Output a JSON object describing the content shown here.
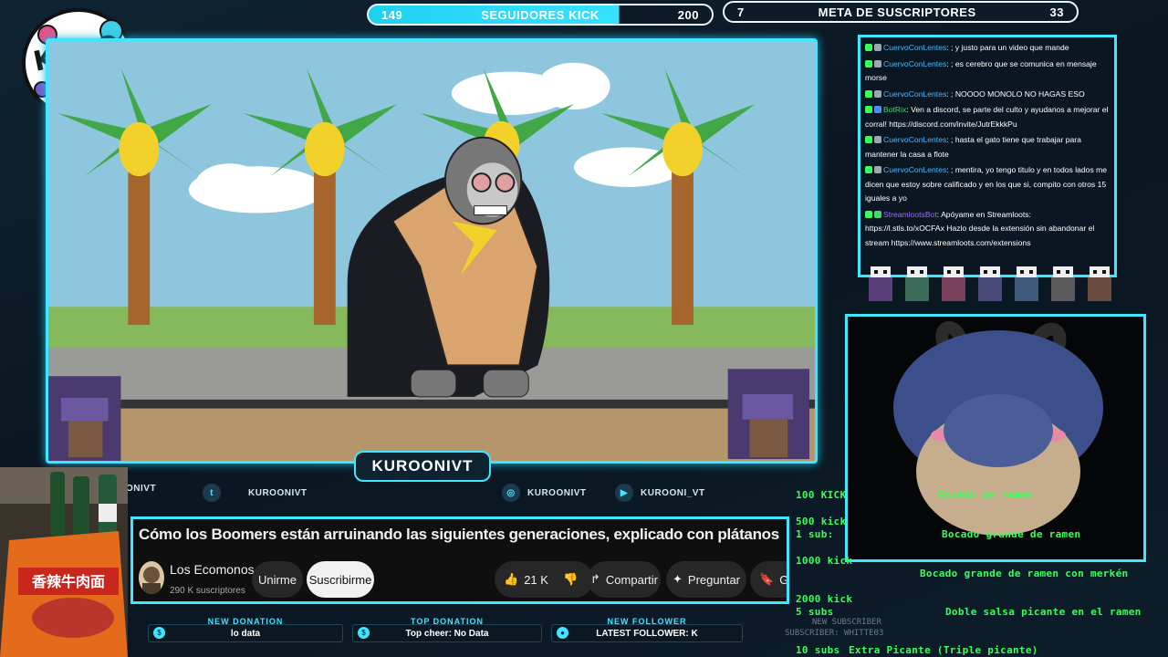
{
  "kick_followers_bar": {
    "start": "149",
    "label": "SEGUIDORES KICK",
    "goal": "200",
    "progress": 0.73
  },
  "subs_goal_bar": {
    "start": "7",
    "label": "META DE SUSCRIPTORES",
    "goal": "33",
    "progress": 0.0
  },
  "logo": {
    "text": "KUROONI VT"
  },
  "chat": {
    "messages": [
      {
        "user": "CuervoConLentes",
        "text": ": ; y justo para un video que mande",
        "type": "user"
      },
      {
        "user": "CuervoConLentes",
        "text": ": ; es cerebro que se comunica en mensaje morse",
        "type": "user"
      },
      {
        "user": "CuervoConLentes",
        "text": ": ; NOOOO MONOLO NO HAGAS ESO",
        "type": "user"
      },
      {
        "user": "BotRix",
        "text": ": Ven a discord, se parte del culto y ayudanos a mejorar el corral! https://discord.com/invite/JutrEkkkPu",
        "type": "bot"
      },
      {
        "user": "CuervoConLentes",
        "text": ": ; hasta el gato tiene que trabajar para mantener la casa a flote",
        "type": "user"
      },
      {
        "user": "CuervoConLentes",
        "text": ": ; mentira, yo tengo titulo y en todos lados me dicen que estoy sobre calificado y en los que si, compito con otros 15 iguales a yo",
        "type": "user"
      },
      {
        "user": "StreamlootsBot",
        "text": ": Apóyame en Streamloots: https://l.stls.to/xOCFAx Hazlo desde la extensión sin abandonar el stream https://www.streamloots.com/extensions",
        "type": "sl"
      }
    ]
  },
  "nametag": "KUROONIVT",
  "socials": [
    {
      "icon": "twitter-icon",
      "glyph": "t",
      "handle": "KUROONIVT"
    },
    {
      "icon": "instagram-icon",
      "glyph": "◎",
      "handle": "KUROONIVT"
    },
    {
      "icon": "youtube-icon",
      "glyph": "▶",
      "handle": "KUROONI_VT"
    }
  ],
  "social_left_partial": "ONIVT",
  "youtube": {
    "title": "Cómo los Boomers están arruinando las siguientes generaciones, explicado con plátanos",
    "channel": "Los Ecomonos",
    "subs": "290 K suscriptores",
    "join": "Unirme",
    "subscribe": "Suscribirme",
    "likes": "21 K",
    "share": "Compartir",
    "ask": "Preguntar",
    "save": "Gu"
  },
  "alerts": [
    {
      "label": "NEW DONATION",
      "value": "lo data"
    },
    {
      "label": "TOP DONATION",
      "value": "Top cheer: No Data"
    },
    {
      "label": "NEW FOLLOWER",
      "value": "LATEST FOLLOWER: K"
    }
  ],
  "new_subscriber": {
    "label": "NEW SUBSCRIBER",
    "value": "SUBSCRIBER: WHITTE03"
  },
  "rewards": [
    {
      "cost": "100 KICK",
      "reward": "Bocado de ramen"
    },
    {
      "cost": "500 kick",
      "reward": ""
    },
    {
      "cost": "1 sub:",
      "reward": "Bocado grande de ramen"
    },
    {
      "cost": "1000 kick",
      "reward": ""
    },
    {
      "cost": "",
      "reward": "Bocado grande de ramen con merkén"
    },
    {
      "cost": "2000 kick",
      "reward": ""
    },
    {
      "cost": "5 subs",
      "reward": "Doble salsa picante en el ramen"
    },
    {
      "cost": "10 subs",
      "reward": "Extra Picante (Triple picante)"
    }
  ],
  "colors": {
    "accent": "#3fe6ff",
    "reward_text": "#39ff5a",
    "yt_bg": "#0f0f0f"
  }
}
